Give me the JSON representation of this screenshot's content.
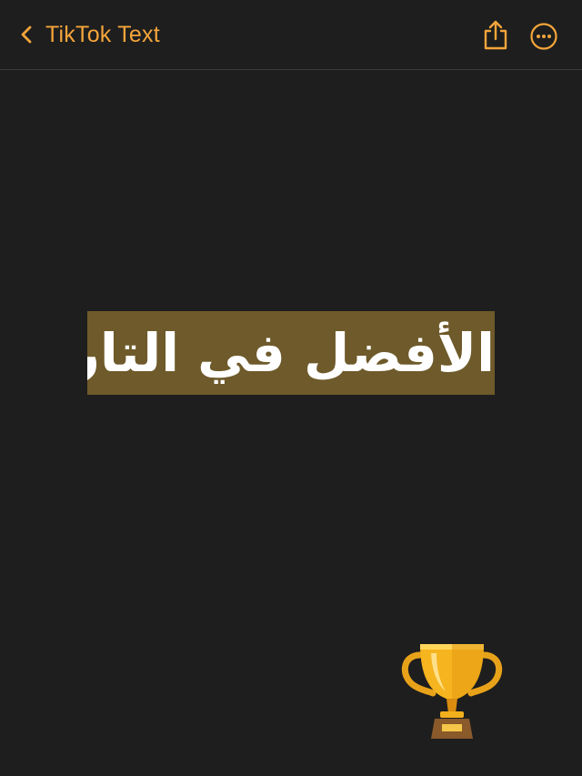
{
  "header": {
    "back_icon": "chevron-left-icon",
    "title": "TikTok Text",
    "share_icon": "share-icon",
    "more_icon": "ellipsis-circle-icon"
  },
  "note": {
    "text": "الأفضل في التاريخ",
    "highlight_color": "#6e5a2a",
    "emoji_icon": "trophy-icon"
  },
  "colors": {
    "background": "#1e1e1e",
    "accent": "#f5a53a",
    "text": "#ffffff"
  }
}
